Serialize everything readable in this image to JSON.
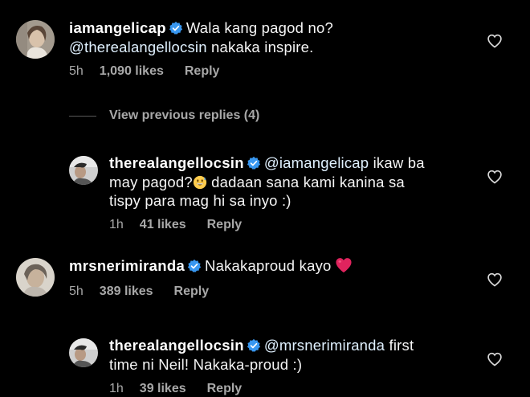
{
  "comments": [
    {
      "username": "iamangelicap",
      "line1": "Wala kang pagod no?",
      "mention": "@therealangellocsin",
      "line2_rest": " nakaka inspire.",
      "time": "5h",
      "likes": "1,090 likes",
      "reply": "Reply"
    },
    {
      "username": "therealangellocsin",
      "mention": "@iamangelicap",
      "line1_rest": " ikaw ba",
      "line2": "may pagod?",
      "line2_rest": " dadaan sana kami kanina sa",
      "line3": "tispy para mag hi sa inyo :)",
      "time": "1h",
      "likes": "41 likes",
      "reply": "Reply"
    },
    {
      "username": "mrsnerimiranda",
      "line1": "Nakakaproud kayo",
      "time": "5h",
      "likes": "389 likes",
      "reply": "Reply"
    },
    {
      "username": "therealangellocsin",
      "mention": "@mrsnerimiranda",
      "line1_rest": " first",
      "line2": "time ni Neil! Nakaka-proud :)",
      "time": "1h",
      "likes": "39 likes",
      "reply": "Reply"
    }
  ],
  "view_previous": "View previous replies (4)",
  "icons": {
    "verified": "verified-badge-icon",
    "like": "heart-outline-icon",
    "emoji_sweat": "grinning-sweat-emoji",
    "emoji_heart": "red-heart-emoji"
  },
  "colors": {
    "background": "#000000",
    "verified": "#3897f0",
    "secondary_text": "#a8a8a8",
    "heart_emoji": "#e0245e"
  }
}
